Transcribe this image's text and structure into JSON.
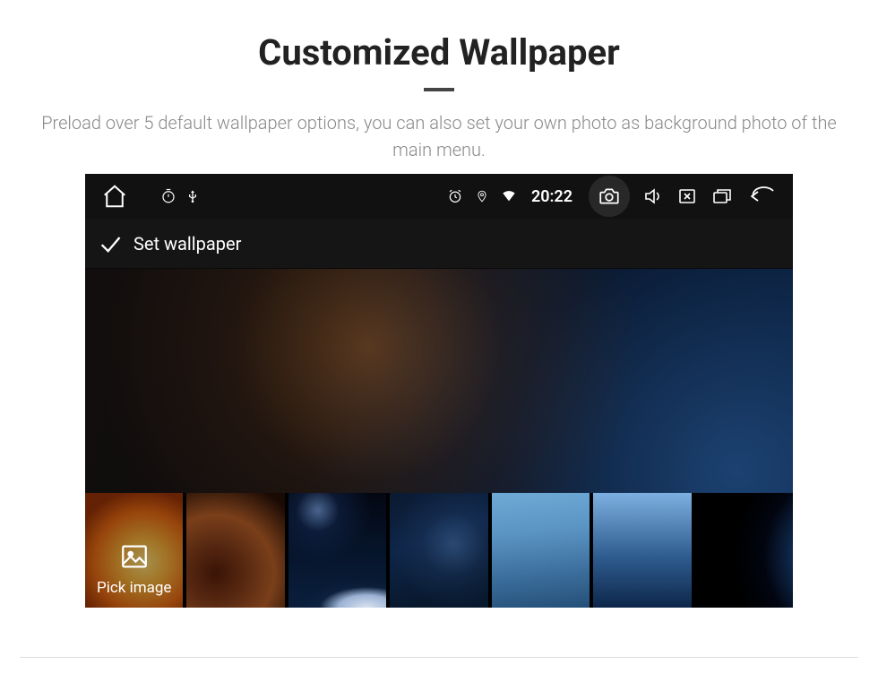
{
  "page": {
    "title": "Customized Wallpaper",
    "subtitle": "Preload over 5 default wallpaper options, you can also set your own photo as background photo of the main menu."
  },
  "statusbar": {
    "time": "20:22"
  },
  "header": {
    "title": "Set wallpaper"
  },
  "thumbs": {
    "pick_label": "Pick image",
    "items": [
      {
        "id": "sunset"
      },
      {
        "id": "planet"
      },
      {
        "id": "navy"
      },
      {
        "id": "sky"
      },
      {
        "id": "bluegrad"
      },
      {
        "id": "earth"
      }
    ]
  }
}
